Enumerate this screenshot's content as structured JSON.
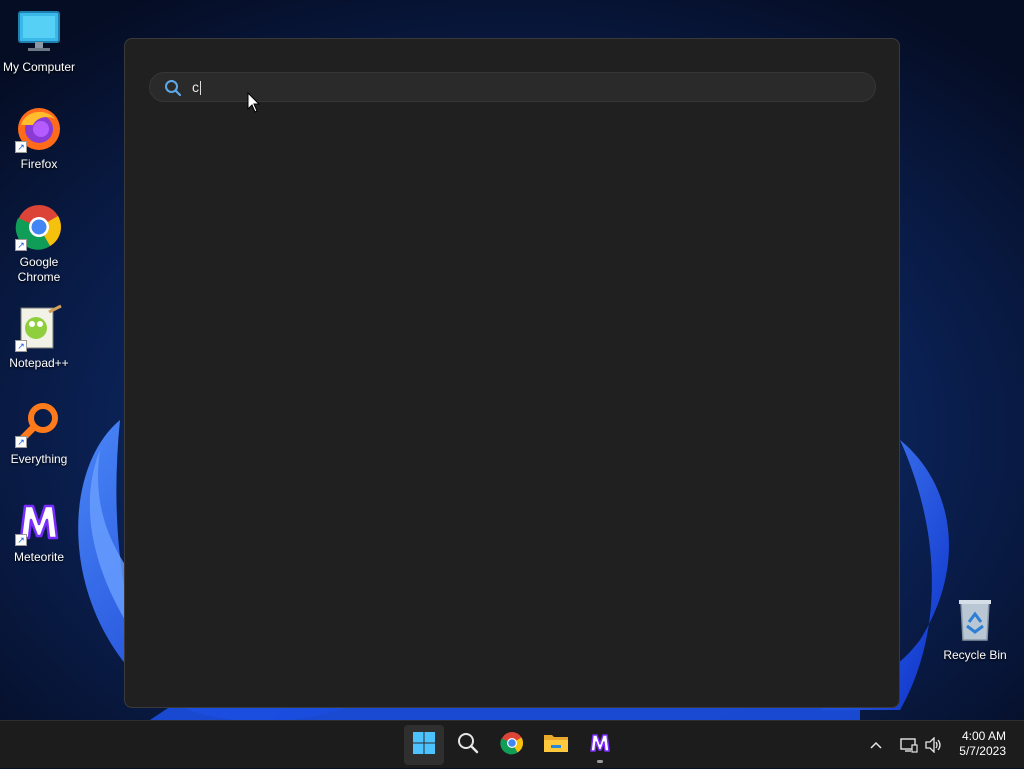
{
  "desktop": {
    "icons": [
      {
        "label": "My Computer",
        "icon": "monitor-icon"
      },
      {
        "label": "Firefox",
        "icon": "firefox-icon"
      },
      {
        "label": "Google Chrome",
        "icon": "chrome-icon"
      },
      {
        "label": "Notepad++",
        "icon": "notepadpp-icon"
      },
      {
        "label": "Everything",
        "icon": "everything-icon"
      },
      {
        "label": "Meteorite",
        "icon": "meteorite-icon"
      }
    ],
    "recycle_bin": {
      "label": "Recycle Bin",
      "icon": "recycle-bin-icon"
    }
  },
  "search": {
    "query": "c",
    "icon": "search-icon"
  },
  "taskbar": {
    "apps": [
      {
        "name": "Start",
        "icon": "windows-start-icon"
      },
      {
        "name": "Search",
        "icon": "search-icon"
      },
      {
        "name": "Google Chrome",
        "icon": "chrome-icon"
      },
      {
        "name": "File Explorer",
        "icon": "folder-icon"
      },
      {
        "name": "Meteorite",
        "icon": "meteorite-icon"
      }
    ],
    "tray": {
      "overflow_icon": "chevron-up-icon",
      "network_icon": "network-icon",
      "volume_icon": "volume-icon"
    },
    "clock": {
      "time": "4:00 AM",
      "date": "5/7/2023"
    }
  },
  "colors": {
    "panel_bg": "#202020",
    "taskbar_bg": "#1c1c1c",
    "accent_blue": "#2b63ff",
    "desktop_bg": "#06102a"
  }
}
